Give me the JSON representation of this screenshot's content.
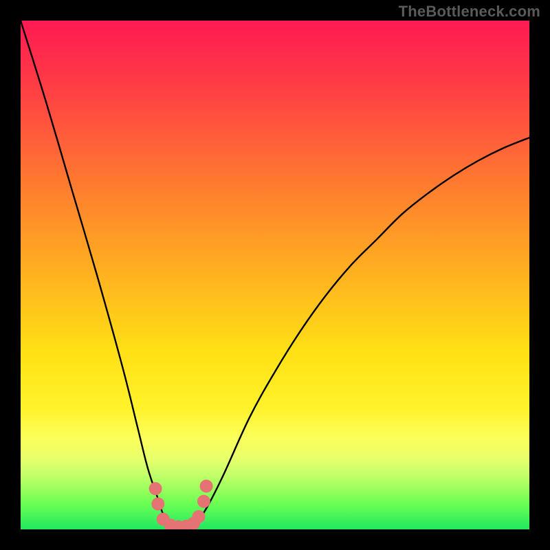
{
  "watermark": "TheBottleneck.com",
  "colors": {
    "page_bg": "#000000",
    "curve": "#000000",
    "marker_fill": "#e57373",
    "marker_stroke": "#e57373",
    "gradient_top": "#ff1a53",
    "gradient_bottom": "#22e760"
  },
  "chart_data": {
    "type": "line",
    "title": "",
    "xlabel": "",
    "ylabel": "",
    "xlim": [
      0,
      100
    ],
    "ylim": [
      0,
      100
    ],
    "grid": false,
    "legend": false,
    "series": [
      {
        "name": "curve",
        "x": [
          0,
          5,
          10,
          15,
          20,
          23,
          25,
          27,
          28,
          29,
          30,
          31,
          32,
          33,
          34,
          35,
          37,
          40,
          45,
          50,
          55,
          60,
          65,
          70,
          75,
          80,
          85,
          90,
          95,
          100
        ],
        "values": [
          100,
          84,
          67,
          50,
          32,
          20,
          12,
          6,
          3,
          1.5,
          0.8,
          0.5,
          0.4,
          0.5,
          0.9,
          1.8,
          5,
          11,
          22,
          31,
          39,
          46,
          52,
          57,
          62,
          66,
          69.5,
          72.5,
          75,
          77
        ]
      }
    ],
    "markers": [
      {
        "x": 26.5,
        "y": 8.0
      },
      {
        "x": 27.0,
        "y": 5.0
      },
      {
        "x": 28.0,
        "y": 2.0
      },
      {
        "x": 29.5,
        "y": 0.8
      },
      {
        "x": 31.0,
        "y": 0.5
      },
      {
        "x": 32.5,
        "y": 0.6
      },
      {
        "x": 34.0,
        "y": 1.2
      },
      {
        "x": 35.0,
        "y": 2.5
      },
      {
        "x": 36.0,
        "y": 5.5
      },
      {
        "x": 36.5,
        "y": 8.5
      }
    ]
  }
}
